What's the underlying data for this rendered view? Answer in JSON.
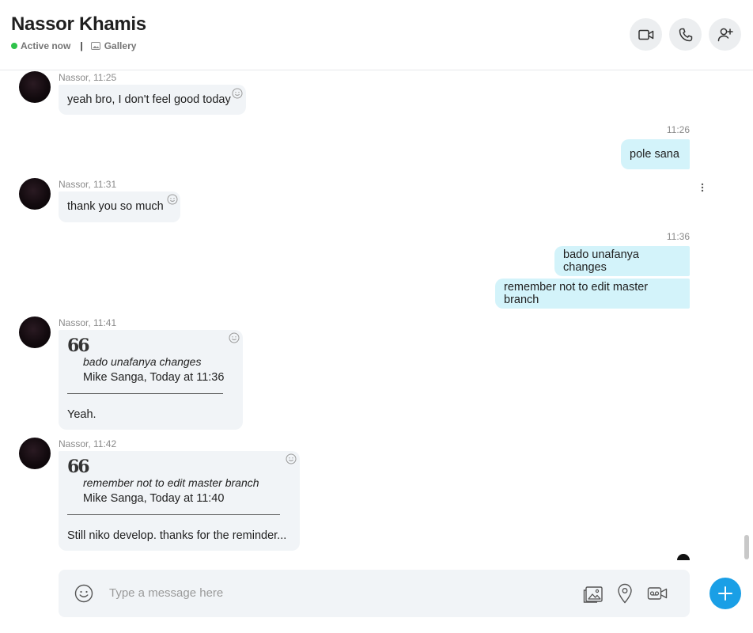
{
  "header": {
    "contact_name": "Nassor Khamis",
    "status": "Active now",
    "separator": "|",
    "gallery_label": "Gallery"
  },
  "messages": [
    {
      "meta": "Nassor, 11:25",
      "text": "yeah bro, I don't feel good today"
    },
    {
      "meta": "11:26",
      "text": "pole sana"
    },
    {
      "meta": "Nassor, 11:31",
      "text": "thank you so much"
    },
    {
      "meta": "11:36",
      "texts": [
        "bado unafanya changes",
        "remember not to edit master branch"
      ]
    },
    {
      "meta": "Nassor, 11:41",
      "quote_mark": "66",
      "quote": "bado unafanya changes",
      "quote_author": "Mike Sanga, Today at 11:36",
      "text": "Yeah."
    },
    {
      "meta": "Nassor, 11:42",
      "quote_mark": "66",
      "quote": "remember not to edit master branch",
      "quote_author": "Mike Sanga, Today at 11:40",
      "text": "Still niko develop. thanks for the reminder..."
    }
  ],
  "composer": {
    "placeholder": "Type a message here"
  },
  "colors": {
    "active_dot": "#2ec24a",
    "incoming_bubble": "#f1f4f7",
    "outgoing_bubble": "#d3f3fa",
    "accent": "#1a9fe6"
  },
  "icons": [
    "video-call-icon",
    "phone-icon",
    "add-person-icon",
    "gallery-icon",
    "smiley-react-icon",
    "more-options-icon",
    "emoji-icon",
    "image-icon",
    "location-icon",
    "video-message-icon",
    "plus-icon"
  ]
}
